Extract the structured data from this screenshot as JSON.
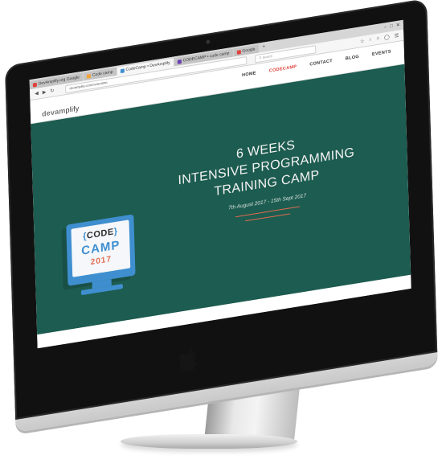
{
  "browser": {
    "tabs": [
      {
        "label": "DevAmplify.org Google",
        "active": false,
        "icon_color": "#e0413a"
      },
      {
        "label": "Code camp",
        "active": false,
        "icon_color": "#f2a33a"
      },
      {
        "label": "CodeCamp • DevAmplify",
        "active": true,
        "icon_color": "#3f8fd0"
      },
      {
        "label": "CODECAMP • code camp",
        "active": false,
        "icon_color": "#6a3fb3"
      },
      {
        "label": "Google",
        "active": false,
        "icon_color": "#e0413a"
      }
    ],
    "url": "devamplify.com/codecamp",
    "search_placeholder": "Search",
    "toolbar_icons": [
      "star-icon",
      "download-icon",
      "home-icon",
      "shield-icon",
      "menu-icon"
    ]
  },
  "site": {
    "logo_mark": "devam",
    "logo_rest": "plify",
    "nav": [
      {
        "label": "HOME",
        "active": false
      },
      {
        "label": "CODECAMP",
        "active": true
      },
      {
        "label": "CONTACT",
        "active": false
      },
      {
        "label": "BLOG",
        "active": false
      },
      {
        "label": "EVENTS",
        "active": false
      }
    ]
  },
  "hero": {
    "title_lines": [
      "6 WEEKS",
      "INTENSIVE PROGRAMMING",
      "TRAINING CAMP"
    ],
    "dates": "7th August 2017 - 15th Sept 2017",
    "badge": {
      "code": "CODE",
      "open_brace": "{",
      "close_brace": "}",
      "camp": "CAMP",
      "year": "2017"
    }
  },
  "colors": {
    "hero_bg": "#1d5c50",
    "accent_red": "#e0413a",
    "accent_orange": "#e26b4e",
    "badge_blue": "#3f8fd0"
  },
  "device": {
    "logo": "apple-icon"
  }
}
